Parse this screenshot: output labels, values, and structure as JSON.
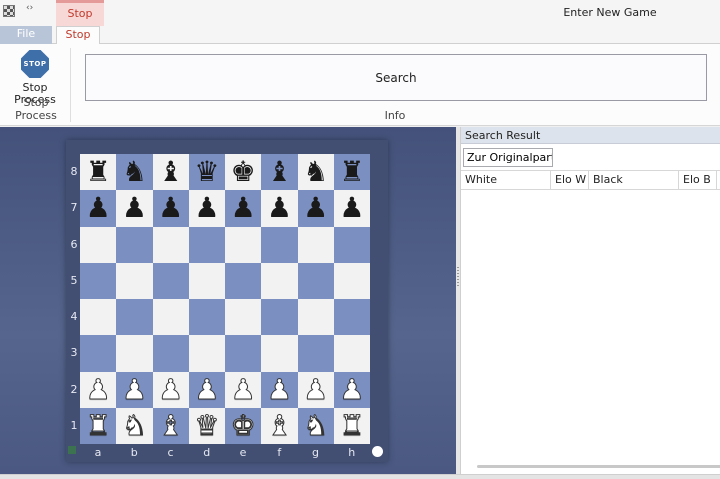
{
  "window": {
    "title": "Enter New Game",
    "context_tab_group": "Stop"
  },
  "tabs": {
    "file_label": "File",
    "stop_label": "Stop"
  },
  "ribbon": {
    "stop_icon_text": "STOP",
    "stop_button_label": "Stop Process",
    "stop_group_label": "Stop Process",
    "search_button_label": "Search",
    "info_group_label": "Info"
  },
  "board": {
    "ranks": [
      "8",
      "7",
      "6",
      "5",
      "4",
      "3",
      "2",
      "1"
    ],
    "files": [
      "a",
      "b",
      "c",
      "d",
      "e",
      "f",
      "g",
      "h"
    ],
    "position": [
      [
        "br",
        "bn",
        "bb",
        "bq",
        "bk",
        "bb",
        "bn",
        "br"
      ],
      [
        "bp",
        "bp",
        "bp",
        "bp",
        "bp",
        "bp",
        "bp",
        "bp"
      ],
      [
        "",
        "",
        "",
        "",
        "",
        "",
        "",
        ""
      ],
      [
        "",
        "",
        "",
        "",
        "",
        "",
        "",
        ""
      ],
      [
        "",
        "",
        "",
        "",
        "",
        "",
        "",
        ""
      ],
      [
        "",
        "",
        "",
        "",
        "",
        "",
        "",
        ""
      ],
      [
        "wp",
        "wp",
        "wp",
        "wp",
        "wp",
        "wp",
        "wp",
        "wp"
      ],
      [
        "wr",
        "wn",
        "wb",
        "wq",
        "wk",
        "wb",
        "wn",
        "wr"
      ]
    ],
    "side_to_move": "white",
    "colors": {
      "light": "#f2f2f2",
      "dark": "#7b8fc0",
      "frame": "#434f72"
    }
  },
  "search_result": {
    "title": "Search Result",
    "original_game_button": "Zur Originalpartie",
    "columns": [
      "White",
      "Elo W",
      "Black",
      "Elo B"
    ],
    "rows": []
  },
  "icons": {
    "app": "chessboard-app-icon",
    "qat": "quick-access-arrow-icon",
    "stop": "stop-sign-icon"
  }
}
